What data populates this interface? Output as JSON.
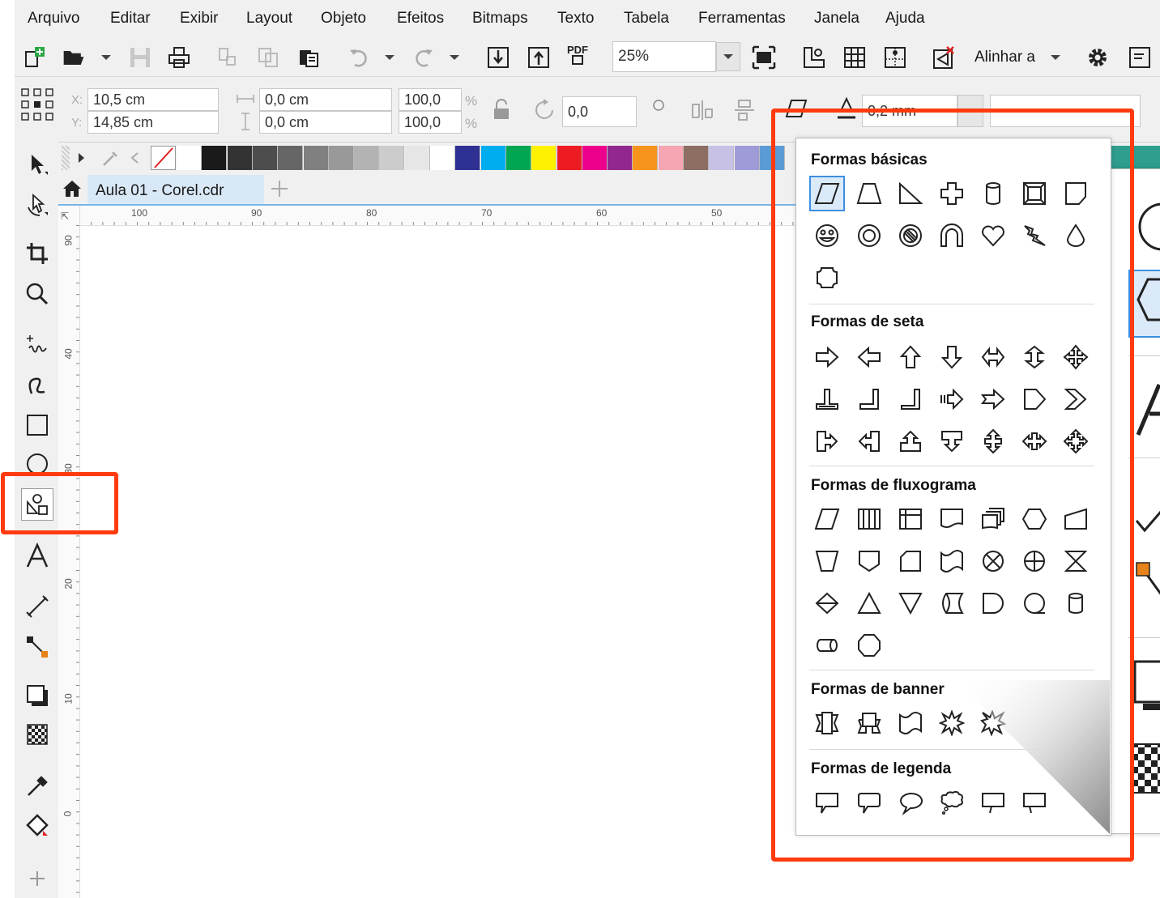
{
  "menu": [
    "Arquivo",
    "Editar",
    "Exibir",
    "Layout",
    "Objeto",
    "Efeitos",
    "Bitmaps",
    "Texto",
    "Tabela",
    "Ferramentas",
    "Janela",
    "Ajuda"
  ],
  "toolbar": {
    "zoom_value": "25%",
    "align_label": "Alinhar a",
    "pdf_label": "PDF"
  },
  "properties": {
    "x_label": "X:",
    "y_label": "Y:",
    "x_value": "10,5 cm",
    "y_value": "14,85 cm",
    "width_value": "0,0 cm",
    "height_value": "0,0 cm",
    "scale_w": "100,0",
    "scale_h": "100,0",
    "percent": "%",
    "rotation": "0,0",
    "outline": "0,2 mm"
  },
  "document": {
    "tab_title": "Aula 01 - Corel.cdr",
    "ruler_h": [
      "100",
      "90",
      "80",
      "70",
      "60",
      "50"
    ],
    "ruler_v": [
      "90",
      "40",
      "30",
      "20",
      "10",
      "0"
    ]
  },
  "palette_colors": [
    "#ffffff",
    "#1a1a1a",
    "#333333",
    "#4d4d4d",
    "#666666",
    "#808080",
    "#999999",
    "#b3b3b3",
    "#cccccc",
    "#e6e6e6",
    "#ffffff",
    "#2e3192",
    "#00aeef",
    "#00a651",
    "#fff200",
    "#ed1c24",
    "#ec008c",
    "#92278f",
    "#f7941d",
    "#f6a6b2",
    "#8c6e63",
    "#c8c1e6",
    "#9e9bd8",
    "#5b9bd5"
  ],
  "flyout": {
    "basic_title": "Formas básicas",
    "arrow_title": "Formas de seta",
    "flow_title": "Formas de fluxograma",
    "banner_title": "Formas de banner",
    "callout_title": "Formas de legenda"
  },
  "accent_color": "#ff3b0f"
}
